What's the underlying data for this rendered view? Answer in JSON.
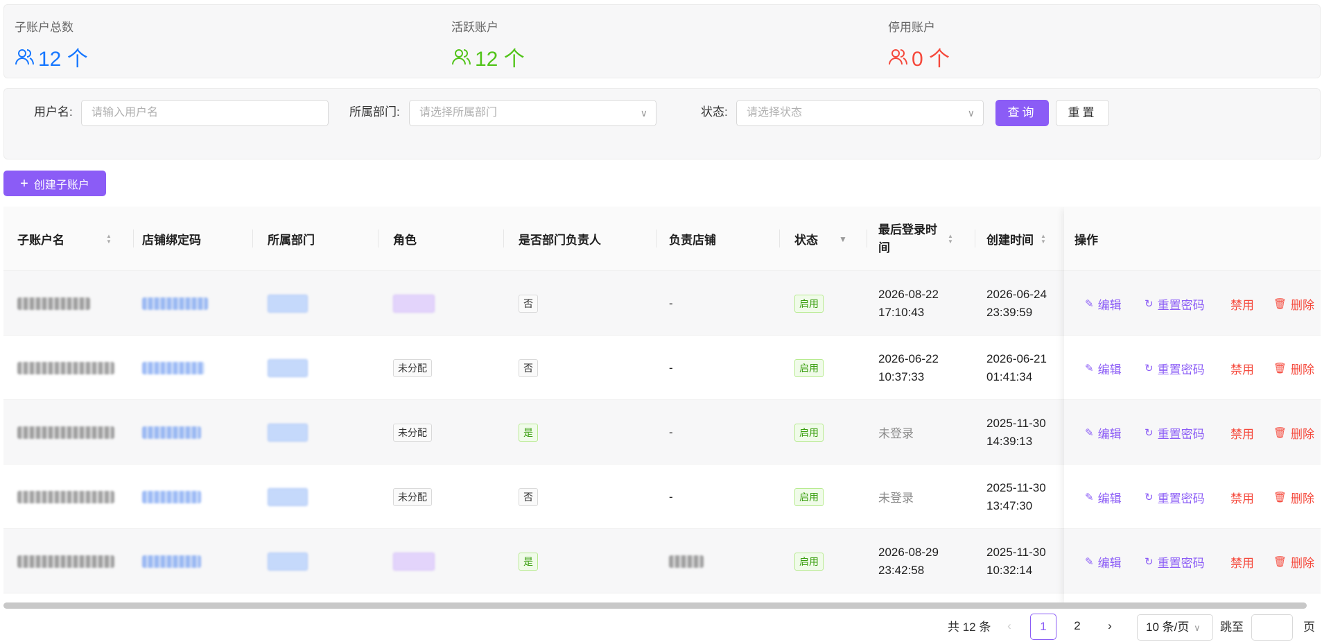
{
  "stats": [
    {
      "label": "子账户总数",
      "value": "12 个",
      "color": "#1677ff",
      "icon": "users-icon"
    },
    {
      "label": "活跃账户",
      "value": "12 个",
      "color": "#52c41a",
      "icon": "users-icon"
    },
    {
      "label": "停用账户",
      "value": "0 个",
      "color": "#f5483b",
      "icon": "users-icon"
    }
  ],
  "filters": {
    "username_label": "用户名:",
    "username_placeholder": "请输入用户名",
    "dept_label": "所属部门:",
    "dept_placeholder": "请选择所属部门",
    "status_label": "状态:",
    "status_placeholder": "请选择状态",
    "query_label": "查询",
    "reset_label": "重置"
  },
  "create_label": "创建子账户",
  "columns": [
    "子账户名",
    "店铺绑定码",
    "所属部门",
    "角色",
    "是否部门负责人",
    "负责店铺",
    "状态",
    "最后登录时间",
    "创建时间",
    "操作"
  ],
  "rows": [
    {
      "role": "",
      "is_head": "否",
      "store": "-",
      "status": "启用",
      "last_login": [
        "2026-08-22",
        "17:10:43"
      ],
      "created": [
        "2026-06-24",
        "23:39:59"
      ]
    },
    {
      "role": "未分配",
      "is_head": "否",
      "store": "-",
      "status": "启用",
      "last_login": [
        "2026-06-22",
        "10:37:33"
      ],
      "created": [
        "2026-06-21",
        "01:41:34"
      ]
    },
    {
      "role": "未分配",
      "is_head": "是",
      "store": "-",
      "status": "启用",
      "last_login": [
        "未登录"
      ],
      "created": [
        "2025-11-30",
        "14:39:13"
      ]
    },
    {
      "role": "未分配",
      "is_head": "否",
      "store": "-",
      "status": "启用",
      "last_login": [
        "未登录"
      ],
      "created": [
        "2025-11-30",
        "13:47:30"
      ]
    },
    {
      "role": "",
      "is_head": "是",
      "store": "",
      "status": "启用",
      "last_login": [
        "2026-08-29",
        "23:42:58"
      ],
      "created": [
        "2025-11-30",
        "10:32:14"
      ]
    }
  ],
  "actions": {
    "edit": "编辑",
    "reset_pwd": "重置密码",
    "disable": "禁用",
    "delete": "删除"
  },
  "pagination": {
    "total": "共 12 条",
    "pages": [
      "1",
      "2"
    ],
    "current": "1",
    "page_size": "10 条/页",
    "jump_label": "跳至",
    "page_suffix": "页"
  }
}
